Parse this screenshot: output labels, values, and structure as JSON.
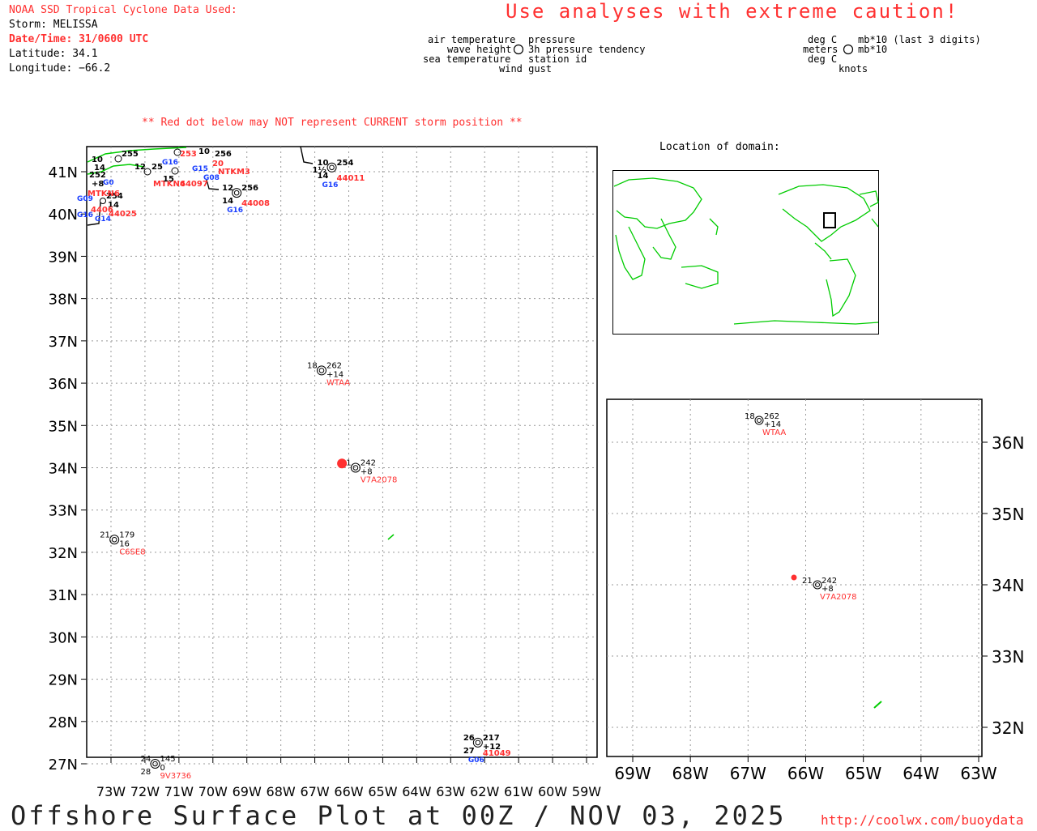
{
  "header": {
    "source_line": "NOAA SSD Tropical Cyclone Data Used:",
    "storm": "Storm: MELISSA",
    "datetime": "Date/Time: 31/0600 UTC",
    "latitude": "Latitude: 34.1",
    "longitude": "Longitude: −66.2",
    "caution": "Use analyses with extreme caution!",
    "red_dot_note": "** Red dot below may NOT represent CURRENT storm position **"
  },
  "legend": {
    "left": {
      "air_temperature": "air temperature",
      "wave_height": "wave height",
      "sea_temperature": "sea temperature",
      "pressure": "pressure",
      "pressure_tendency": "3h pressure tendency",
      "station_id": "station id",
      "wind_gust": "wind gust"
    },
    "right": {
      "deg_c_1": "deg C",
      "meters": "meters",
      "deg_c_2": "deg C",
      "mb_last3": "mb*10 (last 3 digits)",
      "mb10": "mb*10",
      "knots": "knots"
    }
  },
  "location_title": "Location of domain:",
  "main_map": {
    "lat_labels": [
      "41N",
      "40N",
      "39N",
      "38N",
      "37N",
      "36N",
      "35N",
      "34N",
      "33N",
      "32N",
      "31N",
      "30N",
      "29N",
      "28N",
      "27N"
    ],
    "lon_labels": [
      "73W",
      "72W",
      "71W",
      "70W",
      "69W",
      "68W",
      "67W",
      "66W",
      "65W",
      "64W",
      "63W",
      "62W",
      "61W",
      "60W",
      "59W"
    ],
    "stations": [
      {
        "id": "WTAA",
        "temp": "18",
        "pressure": "262",
        "tendency": "+14",
        "lat": 36.3,
        "lon": -66.8
      },
      {
        "id": "V7A2078",
        "temp": "21",
        "pressure": "242",
        "tendency": "+8",
        "lat": 34.0,
        "lon": -65.8
      },
      {
        "id": "C6SE8",
        "temp": "21",
        "pressure": "179",
        "tendency": "16",
        "lat": 32.3,
        "lon": -72.9
      },
      {
        "id": "9V3736",
        "temp": "24",
        "sea": "28",
        "pressure": "145",
        "tendency": "0",
        "lat": 27.0,
        "lon": -71.7
      },
      {
        "id": "44011",
        "temp": "10",
        "wave": "1½",
        "sea": "14",
        "pressure": "254",
        "tag": "G16",
        "lat": 41.1,
        "lon": -66.5
      },
      {
        "id": "44008",
        "temp": "12",
        "sea": "14",
        "pressure": "256",
        "tag": "G16",
        "lat": 40.5,
        "lon": -69.3
      },
      {
        "id": "41049",
        "temp": "26",
        "sea": "27",
        "pressure": "217",
        "tendency": "+12",
        "tag": "G06",
        "lat": 27.5,
        "lon": -62.2
      }
    ],
    "cluster_labels": [
      "255",
      "256",
      "254",
      "253",
      "250",
      "252",
      "14",
      "+8",
      "15",
      "12",
      "NTKM3",
      "MTKN6",
      "44097",
      "44025",
      "44066",
      "G09",
      "G14",
      "G16",
      "G08",
      "G15"
    ],
    "storm_position": {
      "lat": 34.1,
      "lon": -66.2
    }
  },
  "inset_map": {
    "lat_labels": [
      "36N",
      "35N",
      "34N",
      "33N",
      "32N"
    ],
    "lon_labels": [
      "69W",
      "68W",
      "67W",
      "66W",
      "65W",
      "64W",
      "63W"
    ],
    "stations": [
      {
        "id": "WTAA",
        "temp": "18",
        "pressure": "262",
        "tendency": "+14"
      },
      {
        "id": "V7A2078",
        "temp": "21",
        "pressure": "242",
        "tendency": "+8"
      }
    ]
  },
  "footer": {
    "title": "Offshore Surface Plot at 00Z / NOV 03, 2025",
    "url": "http://coolwx.com/buoydata"
  },
  "colors": {
    "accent_red": "#ff3030",
    "coast_green": "#00cc00",
    "station_blue": "#1a3fff",
    "grid": "#999999"
  }
}
